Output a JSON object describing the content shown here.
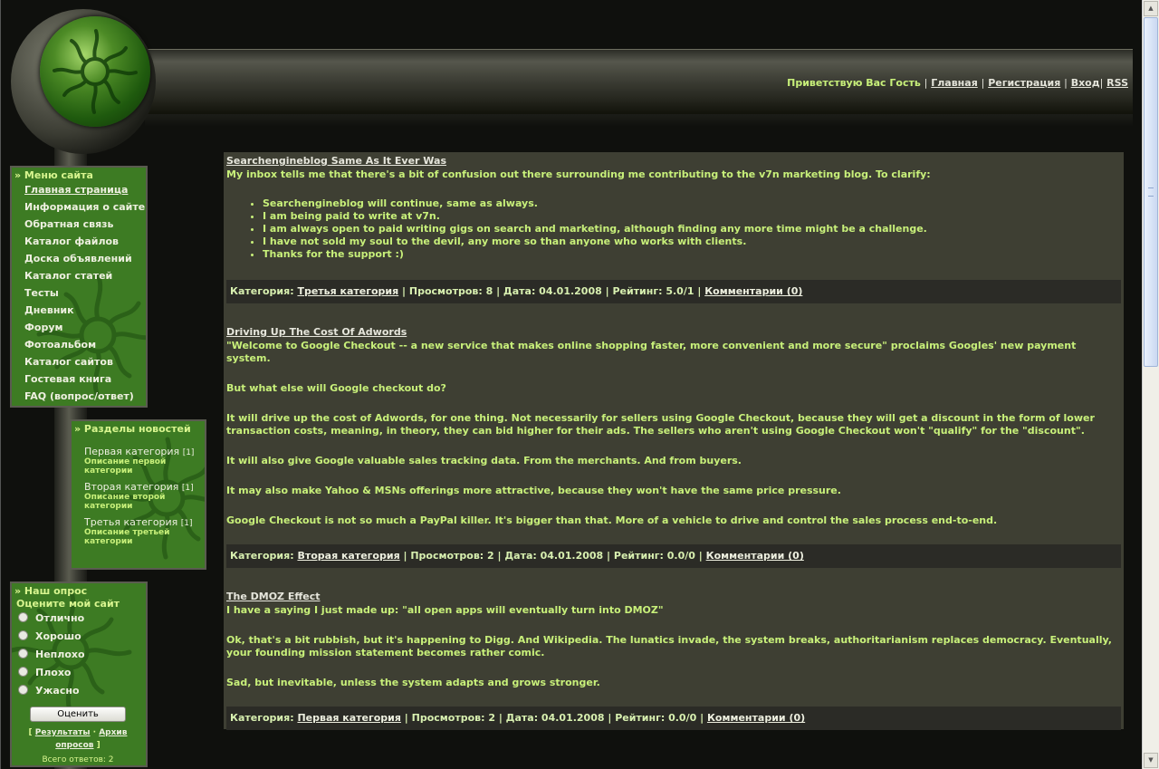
{
  "header": {
    "greeting": "Приветствую Вас Гость",
    "links": [
      "Главная",
      "Регистрация",
      "Вход",
      "RSS"
    ]
  },
  "menu": {
    "title": "» Меню сайта",
    "items": [
      "Главная страница",
      "Информация о сайте",
      "Обратная связь",
      "Каталог файлов",
      "Доска объявлений",
      "Каталог статей",
      "Тесты",
      "Дневник",
      "Форум",
      "Фотоальбом",
      "Каталог сайтов",
      "Гостевая книга",
      "FAQ (вопрос/ответ)"
    ]
  },
  "news_sections": {
    "title": "» Разделы новостей",
    "items": [
      {
        "name": "Первая категория",
        "count": "[1]",
        "desc": "Описание первой категории"
      },
      {
        "name": "Вторая категория",
        "count": "[1]",
        "desc": "Описание второй категории"
      },
      {
        "name": "Третья категория",
        "count": "[1]",
        "desc": "Описание третьей категории"
      }
    ]
  },
  "poll": {
    "title": "» Наш опрос",
    "question": "Оцените мой сайт",
    "options": [
      "Отлично",
      "Хорошо",
      "Неплохо",
      "Плохо",
      "Ужасно"
    ],
    "vote_label": "Оценить",
    "results_label": "Результаты",
    "archive_label": "Архив опросов",
    "total": "Всего ответов: 2"
  },
  "entries": [
    {
      "title": "Searchengineblog Same As It Ever Was",
      "intro": "My inbox tells me that there's a bit of confusion out there surrounding me contributing to the v7n marketing blog. To clarify:",
      "bullets": [
        "Searchengineblog will continue, same as always.",
        "I am being paid to write at v7n.",
        "I am always open to paid writing gigs on search and marketing, although finding any more time might be a challenge.",
        "I have not sold my soul to the devil, any more so than anyone who works with clients.",
        "Thanks for the support :)"
      ],
      "category_label": "Категория:",
      "category": "Третья категория",
      "stats": "| Просмотров: 8 | Дата: 04.01.2008 | Рейтинг: 5.0/1 |",
      "comments": "Комментарии (0)"
    },
    {
      "title": "Driving Up The Cost Of Adwords",
      "paragraphs": [
        "\"Welcome to Google Checkout -- a new service that makes online shopping faster, more convenient and more secure\" proclaims Googles' new payment system.",
        "But what else will Google checkout do?",
        "It will drive up the cost of Adwords, for one thing. Not necessarily for sellers using Google Checkout, because they will get a discount in the form of lower transaction costs, meaning, in theory, they can bid higher for their ads. The sellers who aren't using Google Checkout won't \"qualify\" for the \"discount\".",
        "It will also give Google valuable sales tracking data. From the merchants. And from buyers.",
        "It may also make Yahoo & MSNs offerings more attractive, because they won't have the same price pressure.",
        "Google Checkout is not so much a PayPal killer. It's bigger than that. More of a vehicle to drive and control the sales process end-to-end."
      ],
      "category_label": "Категория:",
      "category": "Вторая категория",
      "stats": "| Просмотров: 2 | Дата: 04.01.2008 | Рейтинг: 0.0/0 |",
      "comments": "Комментарии (0)"
    },
    {
      "title": "The DMOZ Effect",
      "paragraphs": [
        "I have a saying I just made up: \"all open apps will eventually turn into DMOZ\"",
        "Ok, that's a bit rubbish, but it's happening to Digg. And Wikipedia. The lunatics invade, the system breaks, authoritarianism replaces democracy. Eventually, your founding mission statement becomes rather comic.",
        "Sad, but inevitable, unless the system adapts and grows stronger."
      ],
      "category_label": "Категория:",
      "category": "Первая категория",
      "stats": "| Просмотров: 2 | Дата: 04.01.2008 | Рейтинг: 0.0/0 |",
      "comments": "Комментарии (0)"
    }
  ],
  "colors": {
    "text_green": "#c8f07a",
    "box_green": "#3d7b23",
    "content_bg": "#3e3f33",
    "details_bg": "#2b2b26"
  }
}
